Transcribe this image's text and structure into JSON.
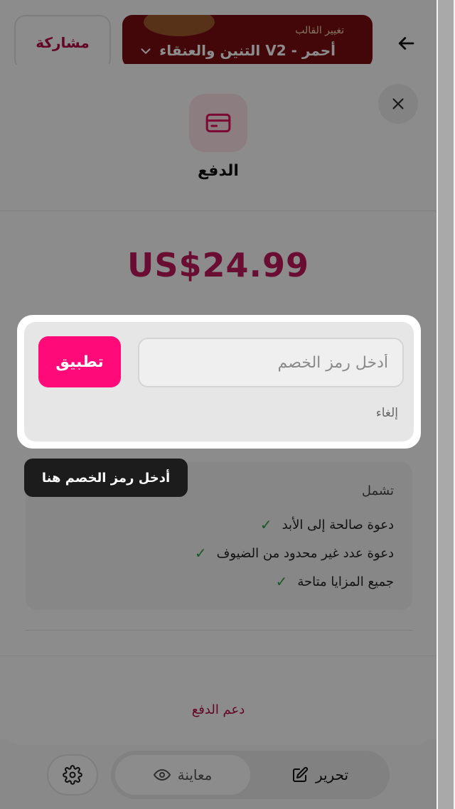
{
  "header": {
    "template_label": "تغيير القالب",
    "template_name": "التنين والعنقاء V2 - أحمر",
    "share_label": "مشاركة"
  },
  "bottom_bar": {
    "edit_label": "تحرير",
    "preview_label": "معاينة"
  },
  "payment_sheet": {
    "title": "الدفع",
    "price": "US$24.99",
    "coupon": {
      "placeholder": "أدخل رمز الخصم",
      "value": "",
      "apply_label": "تطبيق",
      "cancel_label": "إلغاء"
    },
    "tooltip": "أدخل رمز الخصم هنا",
    "includes_title": "تشمل",
    "features": [
      "دعوة صالحة إلى الأبد",
      "دعوة عدد غير محدود من الضيوف",
      "جميع المزايا متاحة"
    ],
    "support_link": "دعم الدفع"
  },
  "colors": {
    "accent": "#ff0a78",
    "brand": "#b50c43",
    "price": "#c2185b",
    "check": "#2e9d4a"
  },
  "icons": [
    "back-arrow-icon",
    "chevron-down-icon",
    "close-icon",
    "credit-card-icon",
    "check-icon",
    "settings-gear-icon",
    "eye-icon",
    "edit-icon"
  ]
}
